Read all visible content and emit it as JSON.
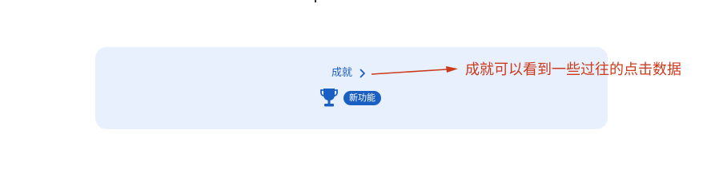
{
  "card": {
    "link_label": "成就",
    "badge_label": "新功能"
  },
  "annotation": {
    "text": "成就可以看到一些过往的点击数据"
  },
  "icons": {
    "chevron": "chevron-right-icon",
    "trophy": "trophy-icon"
  },
  "colors": {
    "card_background": "#e8f0fd",
    "accent_blue": "#1a5fc4",
    "annotation_red": "#cc3a1c"
  }
}
